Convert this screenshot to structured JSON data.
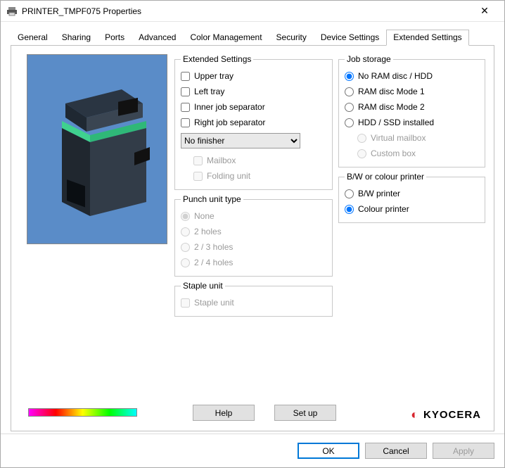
{
  "window": {
    "title": "PRINTER_TMPF075 Properties"
  },
  "tabs": [
    "General",
    "Sharing",
    "Ports",
    "Advanced",
    "Color Management",
    "Security",
    "Device Settings",
    "Extended Settings"
  ],
  "active_tab_index": 7,
  "extended": {
    "legend": "Extended Settings",
    "upper_tray": "Upper tray",
    "left_tray": "Left tray",
    "inner_job_sep": "Inner job separator",
    "right_job_sep": "Right job separator",
    "finisher_selected": "No finisher",
    "mailbox": "Mailbox",
    "folding_unit": "Folding unit"
  },
  "punch": {
    "legend": "Punch unit type",
    "none": "None",
    "h2": "2 holes",
    "h23": "2 / 3 holes",
    "h24": "2 / 4 holes"
  },
  "staple": {
    "legend": "Staple unit",
    "staple_unit": "Staple unit"
  },
  "jobstorage": {
    "legend": "Job storage",
    "no_ram": "No RAM disc / HDD",
    "ram1": "RAM disc Mode 1",
    "ram2": "RAM disc Mode 2",
    "hdd": "HDD / SSD installed",
    "vmail": "Virtual mailbox",
    "cbox": "Custom box"
  },
  "bwcolor": {
    "legend": "B/W or colour printer",
    "bw": "B/W printer",
    "color": "Colour printer"
  },
  "buttons": {
    "help": "Help",
    "setup": "Set up"
  },
  "brand": "KYOCERA",
  "footer": {
    "ok": "OK",
    "cancel": "Cancel",
    "apply": "Apply"
  }
}
